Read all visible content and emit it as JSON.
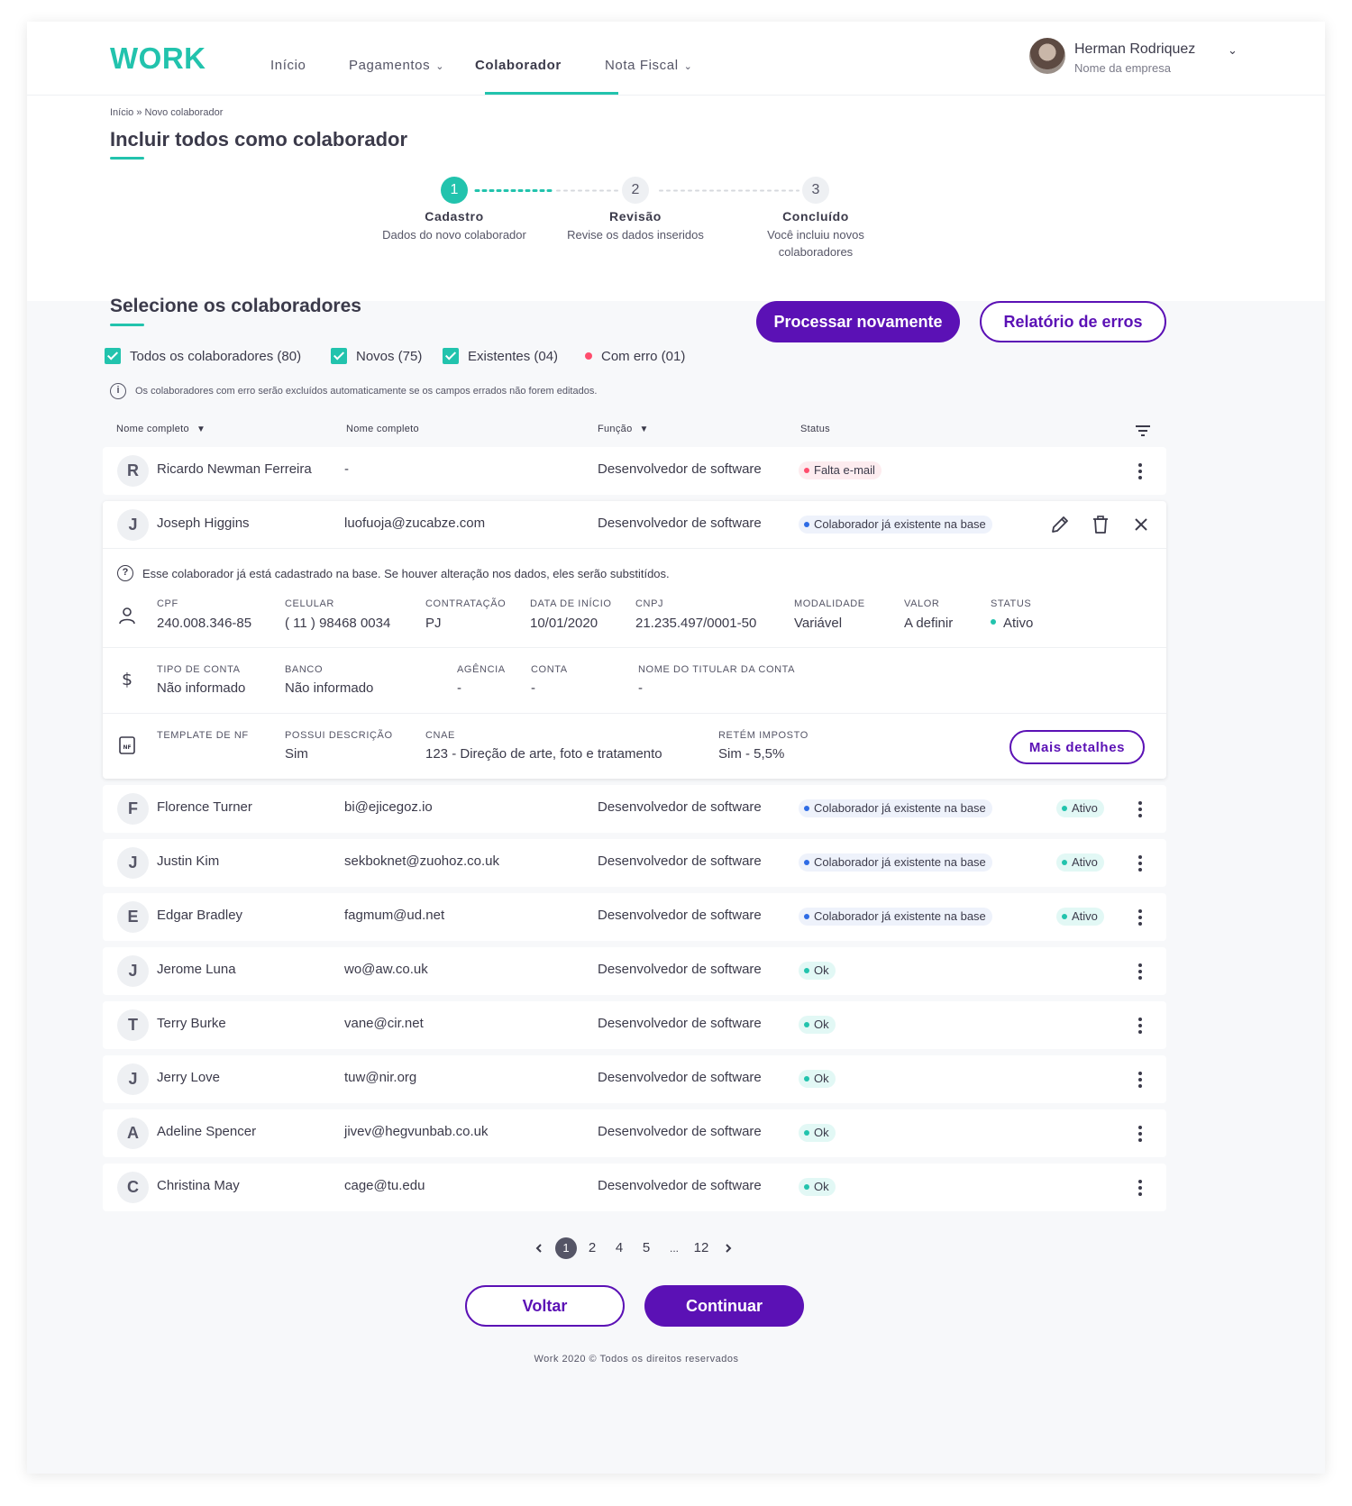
{
  "brand": {
    "logo": "WORK",
    "accent_color": "#22c3ad",
    "primary_color": "#5b11b5"
  },
  "nav": {
    "items": [
      {
        "label": "Início"
      },
      {
        "label": "Pagamentos"
      },
      {
        "label": "Colaborador"
      },
      {
        "label": "Nota Fiscal"
      }
    ],
    "active": "Colaborador"
  },
  "user": {
    "name": "Herman Rodriquez",
    "company": "Nome da empresa"
  },
  "breadcrumb": "Início » Novo colaborador",
  "page_title": "Incluir todos como colaborador",
  "stepper": [
    {
      "number": "1",
      "title": "Cadastro",
      "subtitle": "Dados do novo colaborador"
    },
    {
      "number": "2",
      "title": "Revisão",
      "subtitle": "Revise os dados inseridos"
    },
    {
      "number": "3",
      "title": "Concluído",
      "subtitle_line1": "Você incluiu novos",
      "subtitle_line2": "colaboradores"
    }
  ],
  "section": {
    "title": "Selecione os colaboradores",
    "process_button": "Processar novamente",
    "report_button": "Relatório de erros",
    "filters": {
      "all": "Todos os colaboradores (80)",
      "new": "Novos (75)",
      "existing": "Existentes (04)",
      "error": "Com erro (01)"
    },
    "info": "Os colaboradores com erro serão excluídos automaticamente se os campos errados não forem editados."
  },
  "table": {
    "headers": [
      "Nome completo",
      "Nome completo",
      "Função",
      "Status"
    ],
    "rows": [
      {
        "initial": "R",
        "name": "Ricardo Newman Ferreira",
        "email": "-",
        "role": "Desenvolvedor de software",
        "status": "Falta e-mail",
        "status_type": "error",
        "extra": ""
      },
      {
        "initial": "J",
        "name": "Joseph Higgins",
        "email": "luofuoja@zucabze.com",
        "role": "Desenvolvedor de software",
        "status": "Colaborador já existente na base",
        "status_type": "exists",
        "extra": ""
      },
      {
        "initial": "F",
        "name": "Florence Turner",
        "email": "bi@ejicegoz.io",
        "role": "Desenvolvedor de software",
        "status": "Colaborador já existente na base",
        "status_type": "exists",
        "extra": "Ativo"
      },
      {
        "initial": "J",
        "name": "Justin Kim",
        "email": "sekboknet@zuohoz.co.uk",
        "role": "Desenvolvedor de software",
        "status": "Colaborador já existente na base",
        "status_type": "exists",
        "extra": "Ativo"
      },
      {
        "initial": "E",
        "name": "Edgar Bradley",
        "email": "fagmum@ud.net",
        "role": "Desenvolvedor de software",
        "status": "Colaborador já existente na base",
        "status_type": "exists",
        "extra": "Ativo"
      },
      {
        "initial": "J",
        "name": "Jerome Luna",
        "email": "wo@aw.co.uk",
        "role": "Desenvolvedor de software",
        "status": "Ok",
        "status_type": "ok",
        "extra": ""
      },
      {
        "initial": "T",
        "name": "Terry Burke",
        "email": "vane@cir.net",
        "role": "Desenvolvedor de software",
        "status": "Ok",
        "status_type": "ok",
        "extra": ""
      },
      {
        "initial": "J",
        "name": "Jerry Love",
        "email": "tuw@nir.org",
        "role": "Desenvolvedor de software",
        "status": "Ok",
        "status_type": "ok",
        "extra": ""
      },
      {
        "initial": "A",
        "name": "Adeline Spencer",
        "email": "jivev@hegvunbab.co.uk",
        "role": "Desenvolvedor de software",
        "status": "Ok",
        "status_type": "ok",
        "extra": ""
      },
      {
        "initial": "C",
        "name": "Christina May",
        "email": "cage@tu.edu",
        "role": "Desenvolvedor de software",
        "status": "Ok",
        "status_type": "ok",
        "extra": ""
      }
    ]
  },
  "details": {
    "note": "Esse colaborador já está cadastrado na base. Se houver alteração nos dados, eles serão substitídos.",
    "personal": [
      {
        "label": "CPF",
        "value": "240.008.346-85"
      },
      {
        "label": "CELULAR",
        "value": "( 11 ) 98468 0034"
      },
      {
        "label": "CONTRATAÇÃO",
        "value": "PJ"
      },
      {
        "label": "DATA DE INÍCIO",
        "value": "10/01/2020"
      },
      {
        "label": "CNPJ",
        "value": "21.235.497/0001-50"
      },
      {
        "label": "MODALIDADE",
        "value": "Variável"
      },
      {
        "label": "VALOR",
        "value": "A definir"
      },
      {
        "label": "STATUS",
        "value": "Ativo"
      }
    ],
    "bank": [
      {
        "label": "TIPO DE CONTA",
        "value": "Não informado"
      },
      {
        "label": "BANCO",
        "value": "Não informado"
      },
      {
        "label": "AGÊNCIA",
        "value": "-"
      },
      {
        "label": "CONTA",
        "value": "-"
      },
      {
        "label": "NOME DO TITULAR DA CONTA",
        "value": "-"
      }
    ],
    "invoice": [
      {
        "label": "TEMPLATE DE NF",
        "value": ""
      },
      {
        "label": "POSSUI DESCRIÇÃO",
        "value": "Sim"
      },
      {
        "label": "CNAE",
        "value": "123 - Direção de arte, foto e tratamento"
      },
      {
        "label": "RETÉM IMPOSTO",
        "value": "Sim - 5,5%"
      }
    ],
    "nf_icon_text": "NF",
    "more_button": "Mais detalhes"
  },
  "pagination": {
    "pages": [
      "1",
      "2",
      "4",
      "5",
      "...",
      "12"
    ],
    "current": "1"
  },
  "actions": {
    "back": "Voltar",
    "continue": "Continuar"
  },
  "footer": "Work 2020 © Todos os direitos reservados",
  "icons": [
    "chevron-down-icon",
    "info-icon",
    "sort-down-icon",
    "filter-icon",
    "kebab-icon",
    "pencil-icon",
    "trash-icon",
    "close-icon",
    "question-icon",
    "user-icon",
    "dollar-icon",
    "invoice-icon",
    "chevron-left-icon",
    "chevron-right-icon"
  ]
}
